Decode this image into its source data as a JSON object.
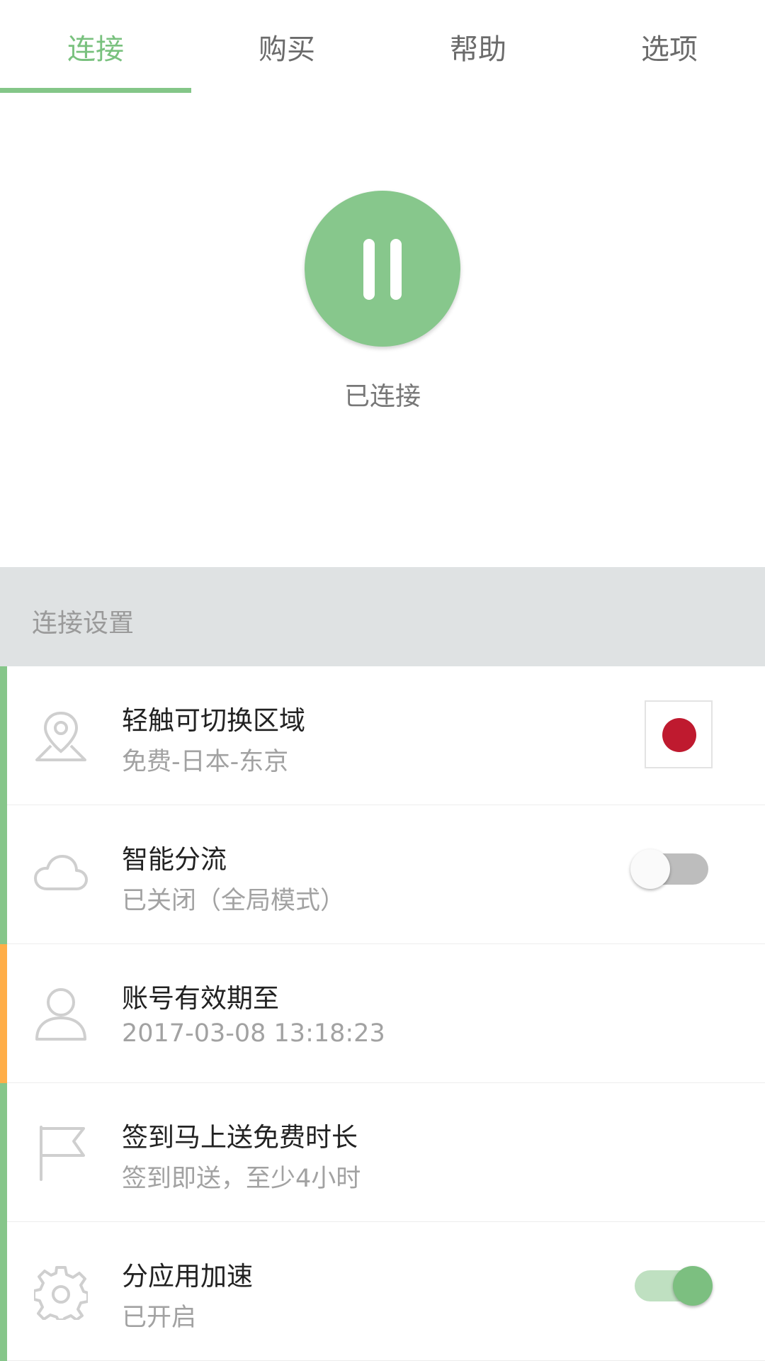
{
  "tabs": [
    {
      "label": "连接",
      "active": true
    },
    {
      "label": "购买",
      "active": false
    },
    {
      "label": "帮助",
      "active": false
    },
    {
      "label": "选项",
      "active": false
    }
  ],
  "connect": {
    "status": "已连接",
    "button_state": "connected",
    "button_icon": "pause-icon"
  },
  "section": {
    "title": "连接设置"
  },
  "rows": [
    {
      "title": "轻触可切换区域",
      "subtitle": "免费-日本-东京",
      "icon": "location-pin-icon",
      "accessory": "japan-flag-icon",
      "accent": "#86c68a"
    },
    {
      "title": "智能分流",
      "subtitle": "已关闭（全局模式）",
      "icon": "cloud-icon",
      "toggle": false,
      "accent": "#86c68a"
    },
    {
      "title": "账号有效期至",
      "subtitle": "2017-03-08 13:18:23",
      "icon": "user-icon",
      "accent": "#ffae48"
    },
    {
      "title": "签到马上送免费时长",
      "subtitle": "签到即送，至少4小时",
      "icon": "flag-icon",
      "accent": "#86c68a"
    },
    {
      "title": "分应用加速",
      "subtitle": "已开启",
      "icon": "gear-icon",
      "toggle": true,
      "accent": "#86c68a"
    }
  ],
  "colors": {
    "accent_green": "#87c78c",
    "accent_orange": "#ffae48",
    "section_bg": "#dfe2e3",
    "flag_red": "#bf1a2f"
  }
}
